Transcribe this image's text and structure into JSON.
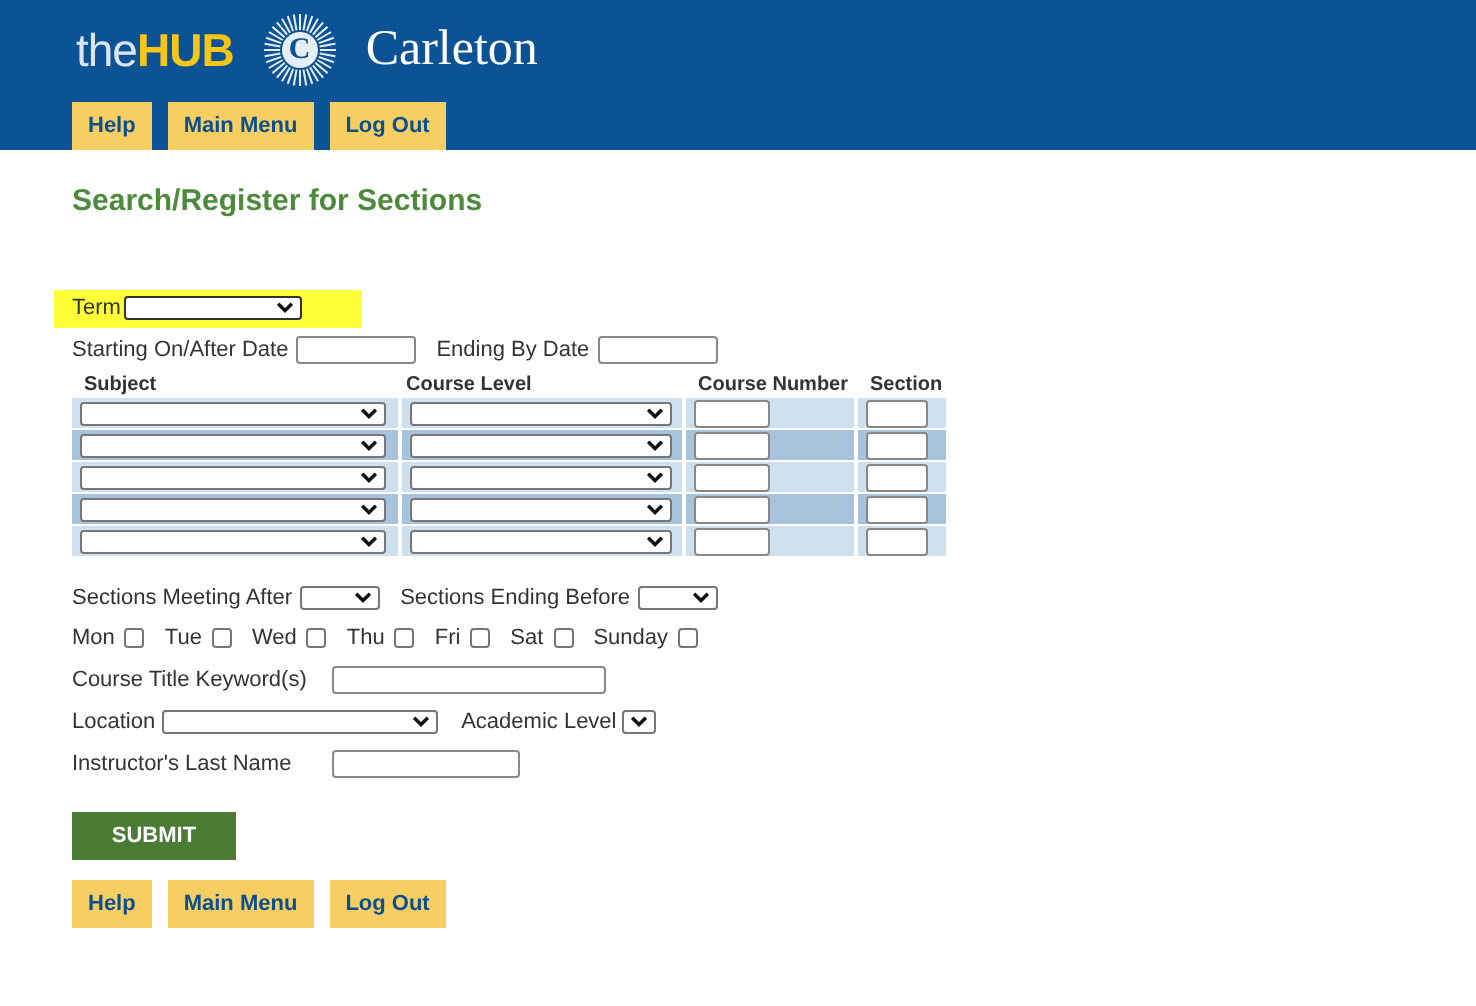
{
  "header": {
    "logo_prefix": "the",
    "logo_brand": "HUB",
    "seal_letter": "C",
    "institution": "Carleton"
  },
  "top_nav": [
    {
      "label": "Help"
    },
    {
      "label": "Main Menu"
    },
    {
      "label": "Log Out"
    }
  ],
  "title": "Search/Register for Sections",
  "term": {
    "label": "Term",
    "highlighted": true
  },
  "dates": [
    {
      "label": "Starting On/After Date"
    },
    {
      "label": "Ending By Date"
    }
  ],
  "course_table": {
    "columns": [
      "Subject",
      "Course Level",
      "Course Number",
      "Section"
    ],
    "rows": [
      {
        "shaded": false
      },
      {
        "shaded": true
      },
      {
        "shaded": false
      },
      {
        "shaded": true
      },
      {
        "shaded": false
      }
    ]
  },
  "meeting_times": [
    {
      "label": "Sections Meeting After"
    },
    {
      "label": "Sections Ending Before"
    }
  ],
  "days": [
    {
      "label": "Mon",
      "checked": false
    },
    {
      "label": "Tue",
      "checked": false
    },
    {
      "label": "Wed",
      "checked": false
    },
    {
      "label": "Thu",
      "checked": false
    },
    {
      "label": "Fri",
      "checked": false
    },
    {
      "label": "Sat",
      "checked": false
    },
    {
      "label": "Sunday",
      "checked": false
    }
  ],
  "keyword": {
    "label": "Course Title Keyword(s)"
  },
  "location": {
    "label": "Location"
  },
  "academic_level": {
    "label": "Academic Level"
  },
  "instructor": {
    "label": "Instructor's Last Name"
  },
  "submit": "SUBMIT",
  "bottom_nav": [
    {
      "label": "Help"
    },
    {
      "label": "Main Menu"
    },
    {
      "label": "Log Out"
    }
  ]
}
